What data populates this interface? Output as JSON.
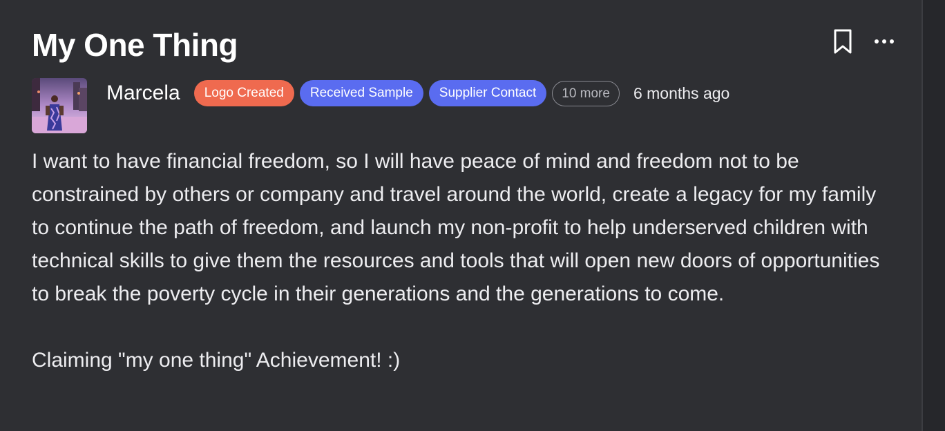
{
  "post": {
    "title": "My One Thing",
    "author": "Marcela",
    "timestamp": "6 months ago",
    "tags": [
      {
        "label": "Logo Created",
        "color": "#ef6a4f"
      },
      {
        "label": "Received Sample",
        "color": "#5a6cf0"
      },
      {
        "label": "Supplier Contact",
        "color": "#5a6cf0"
      }
    ],
    "more_tags_label": "10 more",
    "body_paragraph_1": "I want to have financial freedom, so I will have peace of mind and freedom not to be constrained by others or company and travel around the world, create a legacy for my family to continue the path of freedom, and launch my non-profit to help underserved children with technical skills to give them the resources and tools that will open new doors of opportunities to break the poverty cycle in their generations and the generations to come.",
    "body_paragraph_2": "Claiming \"my one thing\" Achievement! :)"
  },
  "actions": {
    "bookmark_icon": "bookmark-icon",
    "more_icon": "ellipsis-icon"
  },
  "colors": {
    "background": "#2e2f33",
    "tag_orange": "#ef6a4f",
    "tag_blue": "#5a6cf0"
  }
}
